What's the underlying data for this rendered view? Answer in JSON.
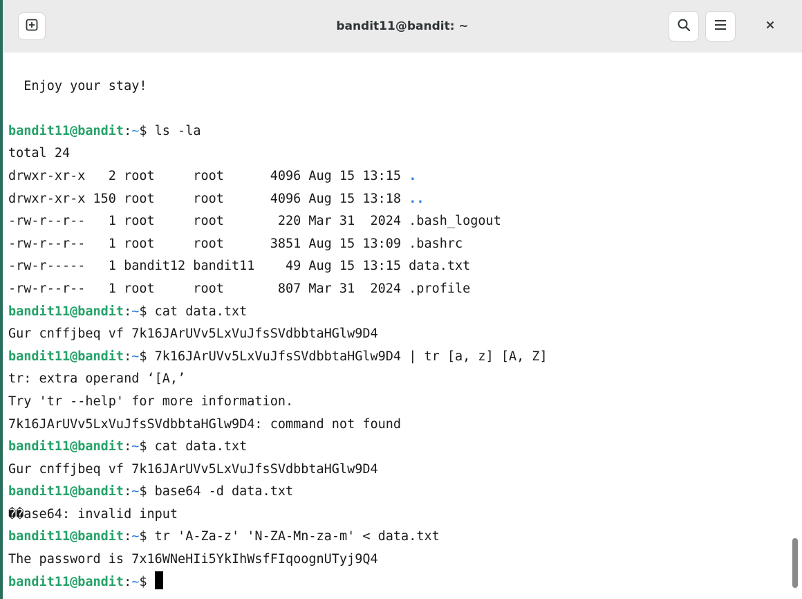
{
  "window": {
    "title": "bandit11@bandit: ~"
  },
  "icons": {
    "new_tab": "new-tab-icon",
    "search": "search-icon",
    "menu": "hamburger-menu-icon",
    "close": "close-icon"
  },
  "colors": {
    "prompt_user": "#26a269",
    "prompt_path": "#2a7bde",
    "dir_name": "#2a7bde"
  },
  "terminal": {
    "lines": [
      {
        "type": "blank"
      },
      {
        "type": "output",
        "text": "  Enjoy your stay!"
      },
      {
        "type": "blank"
      },
      {
        "type": "prompt",
        "user": "bandit11@bandit",
        "sep": ":",
        "path": "~",
        "sign": "$ ",
        "cmd": "ls -la"
      },
      {
        "type": "output",
        "text": "total 24"
      },
      {
        "type": "lsrow",
        "text": "drwxr-xr-x   2 root     root      4096 Aug 15 13:15 ",
        "name": "."
      },
      {
        "type": "lsrow",
        "text": "drwxr-xr-x 150 root     root      4096 Aug 15 13:18 ",
        "name": ".."
      },
      {
        "type": "output",
        "text": "-rw-r--r--   1 root     root       220 Mar 31  2024 .bash_logout"
      },
      {
        "type": "output",
        "text": "-rw-r--r--   1 root     root      3851 Aug 15 13:09 .bashrc"
      },
      {
        "type": "output",
        "text": "-rw-r-----   1 bandit12 bandit11    49 Aug 15 13:15 data.txt"
      },
      {
        "type": "output",
        "text": "-rw-r--r--   1 root     root       807 Mar 31  2024 .profile"
      },
      {
        "type": "prompt",
        "user": "bandit11@bandit",
        "sep": ":",
        "path": "~",
        "sign": "$ ",
        "cmd": "cat data.txt"
      },
      {
        "type": "output",
        "text": "Gur cnffjbeq vf 7k16JArUVv5LxVuJfsSVdbbtaHGlw9D4"
      },
      {
        "type": "prompt",
        "user": "bandit11@bandit",
        "sep": ":",
        "path": "~",
        "sign": "$ ",
        "cmd": "7k16JArUVv5LxVuJfsSVdbbtaHGlw9D4 | tr [a, z] [A, Z]"
      },
      {
        "type": "output",
        "text": "tr: extra operand ‘[A,’"
      },
      {
        "type": "output",
        "text": "Try 'tr --help' for more information."
      },
      {
        "type": "output",
        "text": "7k16JArUVv5LxVuJfsSVdbbtaHGlw9D4: command not found"
      },
      {
        "type": "prompt",
        "user": "bandit11@bandit",
        "sep": ":",
        "path": "~",
        "sign": "$ ",
        "cmd": "cat data.txt"
      },
      {
        "type": "output",
        "text": "Gur cnffjbeq vf 7k16JArUVv5LxVuJfsSVdbbtaHGlw9D4"
      },
      {
        "type": "prompt",
        "user": "bandit11@bandit",
        "sep": ":",
        "path": "~",
        "sign": "$ ",
        "cmd": "base64 -d data.txt"
      },
      {
        "type": "output",
        "text": "��ase64: invalid input"
      },
      {
        "type": "prompt",
        "user": "bandit11@bandit",
        "sep": ":",
        "path": "~",
        "sign": "$ ",
        "cmd": "tr 'A-Za-z' 'N-ZA-Mn-za-m' < data.txt"
      },
      {
        "type": "output",
        "text": "The password is 7x16WNeHIi5YkIhWsfFIqoognUTyj9Q4"
      },
      {
        "type": "prompt",
        "user": "bandit11@bandit",
        "sep": ":",
        "path": "~",
        "sign": "$ ",
        "cmd": "",
        "cursor": true
      }
    ]
  }
}
